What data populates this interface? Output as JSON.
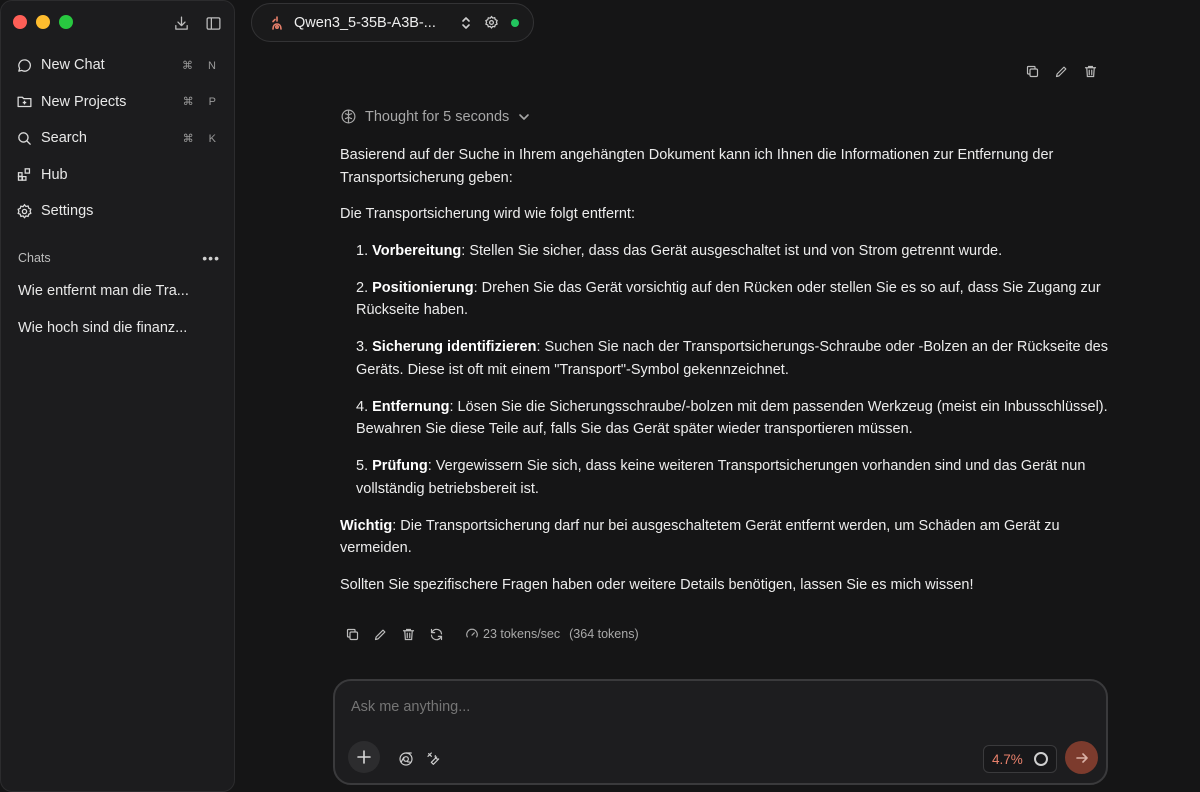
{
  "sidebar": {
    "window_controls": [
      "close",
      "minimize",
      "maximize"
    ],
    "top_icons": [
      "download-icon",
      "sidebar-toggle-icon"
    ],
    "nav": [
      {
        "label": "New Chat",
        "icon": "chat-bubble-icon",
        "shortcut": "⌘ N"
      },
      {
        "label": "New Projects",
        "icon": "folder-plus-icon",
        "shortcut": "⌘ P"
      },
      {
        "label": "Search",
        "icon": "search-icon",
        "shortcut": "⌘ K"
      },
      {
        "label": "Hub",
        "icon": "grid-icon",
        "shortcut": ""
      },
      {
        "label": "Settings",
        "icon": "gear-icon",
        "shortcut": ""
      }
    ],
    "chats_label": "Chats",
    "chats_more": "•••",
    "chats": [
      {
        "title": "Wie entfernt man die Tra..."
      },
      {
        "title": "Wie hoch sind die finanz..."
      }
    ]
  },
  "header": {
    "model_name": "Qwen3_5-35B-A3B-...",
    "status_color": "#22c55e"
  },
  "message": {
    "thought_label": "Thought for 5 seconds",
    "intro": "Basierend auf der Suche in Ihrem angehängten Dokument kann ich Ihnen die Informationen zur Entfernung der Transportsicherung geben:",
    "steps_intro": "Die Transportsicherung wird wie folgt entfernt:",
    "steps": [
      {
        "num": "1. ",
        "title": "Vorbereitung",
        "text": ": Stellen Sie sicher, dass das Gerät ausgeschaltet ist und von Strom getrennt wurde."
      },
      {
        "num": "2. ",
        "title": "Positionierung",
        "text": ": Drehen Sie das Gerät vorsichtig auf den Rücken oder stellen Sie es so auf, dass Sie Zugang zur Rückseite haben."
      },
      {
        "num": "3. ",
        "title": "Sicherung identifizieren",
        "text": ": Suchen Sie nach der Transportsicherungs-Schraube oder -Bolzen an der Rückseite des Geräts. Diese ist oft mit einem \"Transport\"-Symbol gekennzeichnet."
      },
      {
        "num": "4. ",
        "title": "Entfernung",
        "text": ": Lösen Sie die Sicherungsschraube/-bolzen mit dem passenden Werkzeug (meist ein Inbusschlüssel). Bewahren Sie diese Teile auf, falls Sie das Gerät später wieder transportieren müssen."
      },
      {
        "num": "5. ",
        "title": "Prüfung",
        "text": ": Vergewissern Sie sich, dass keine weiteren Transportsicherungen vorhanden sind und das Gerät nun vollständig betriebsbereit ist."
      }
    ],
    "warning_title": "Wichtig",
    "warning_text": ": Die Transportsicherung darf nur bei ausgeschaltetem Gerät entfernt werden, um Schäden am Gerät zu vermeiden.",
    "closing": "Sollten Sie spezifischere Fragen haben oder weitere Details benötigen, lassen Sie es mich wissen!",
    "speed": "23 tokens/sec",
    "total_tokens": "(364 tokens)"
  },
  "composer": {
    "placeholder": "Ask me anything...",
    "context_usage": "4.7%",
    "accent_color": "#e8806b"
  }
}
